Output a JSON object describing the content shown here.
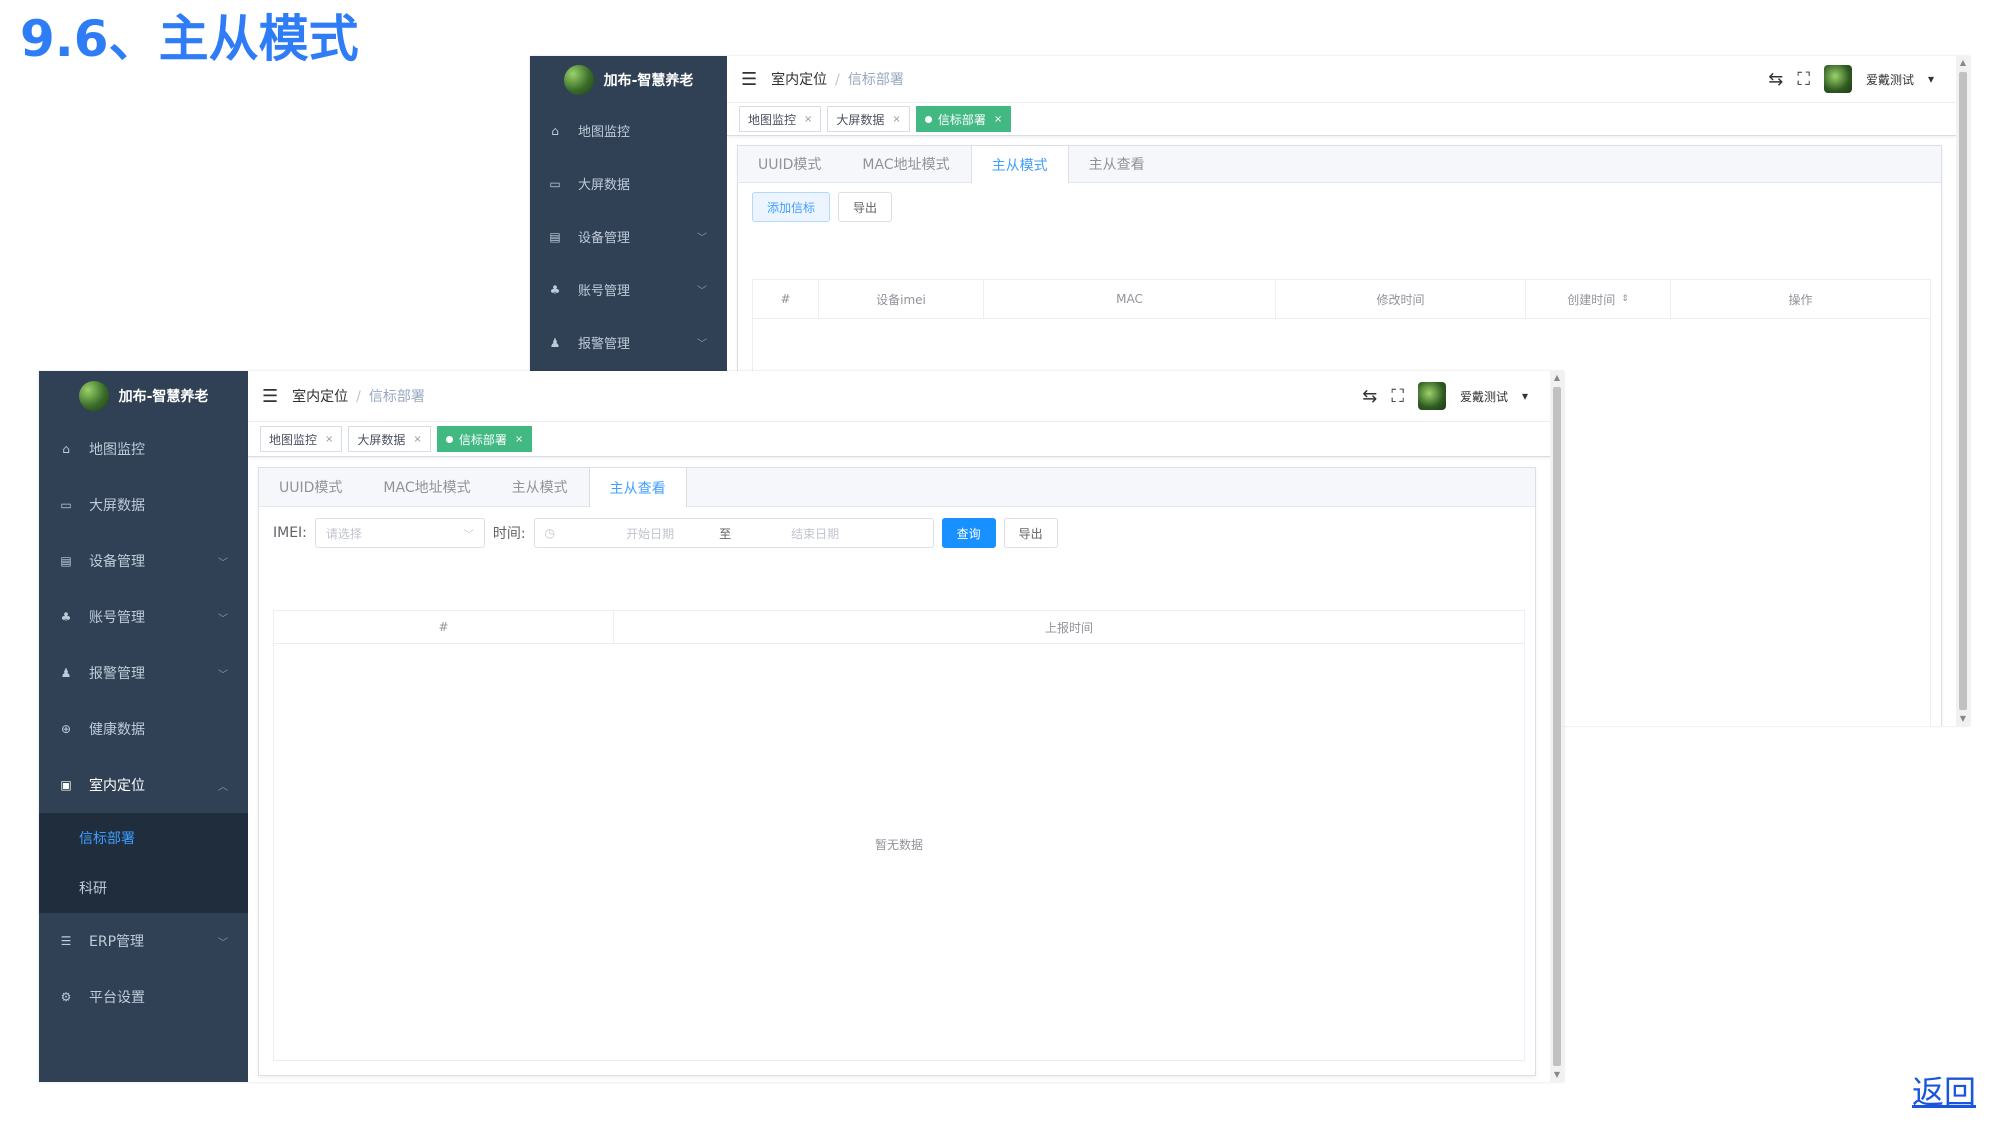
{
  "slide": {
    "title": "9.6、主从模式",
    "back_label": "返回"
  },
  "app": {
    "brand": "加布-智慧养老",
    "user": "爱戴测试",
    "breadcrumb": {
      "parent": "室内定位",
      "current": "信标部署"
    },
    "open_tags": [
      {
        "label": "地图监控"
      },
      {
        "label": "大屏数据"
      },
      {
        "label": "信标部署"
      }
    ],
    "tabs": [
      "UUID模式",
      "MAC地址模式",
      "主从模式",
      "主从查看"
    ]
  },
  "back_window": {
    "menu": [
      {
        "label": "地图监控",
        "icon": "home-icon"
      },
      {
        "label": "大屏数据",
        "icon": "screen-icon"
      },
      {
        "label": "设备管理",
        "icon": "server-icon"
      },
      {
        "label": "账号管理",
        "icon": "tree-icon"
      },
      {
        "label": "报警管理",
        "icon": "bell-icon"
      }
    ],
    "active_tab": "主从模式",
    "buttons": {
      "add": "添加信标",
      "export": "导出"
    },
    "columns": [
      "#",
      "设备imei",
      "MAC",
      "修改时间",
      "创建时间",
      "操作"
    ]
  },
  "front_window": {
    "menu": [
      {
        "label": "地图监控",
        "icon": "home-icon"
      },
      {
        "label": "大屏数据",
        "icon": "screen-icon"
      },
      {
        "label": "设备管理",
        "icon": "server-icon"
      },
      {
        "label": "账号管理",
        "icon": "tree-icon"
      },
      {
        "label": "报警管理",
        "icon": "bell-icon"
      },
      {
        "label": "健康数据",
        "icon": "health-icon"
      },
      {
        "label": "室内定位",
        "icon": "map-icon"
      }
    ],
    "submenu": [
      {
        "label": "信标部署"
      },
      {
        "label": "科研"
      }
    ],
    "menu_after": [
      {
        "label": "ERP管理",
        "icon": "list-icon"
      },
      {
        "label": "平台设置",
        "icon": "gear-icon"
      }
    ],
    "active_tab": "主从查看",
    "filter": {
      "imei_label": "IMEI:",
      "imei_placeholder": "请选择",
      "time_label": "时间:",
      "start_placeholder": "开始日期",
      "range_sep": "至",
      "end_placeholder": "结束日期",
      "query_label": "查询",
      "export_label": "导出"
    },
    "columns": [
      "#",
      "上报时间"
    ],
    "empty_text": "暂无数据"
  }
}
